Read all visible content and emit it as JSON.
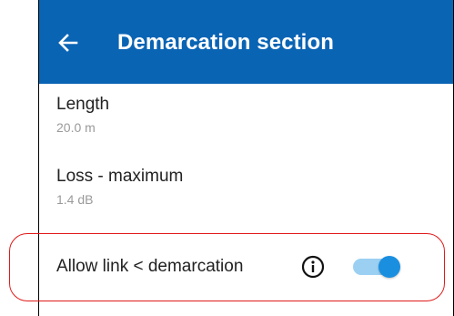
{
  "header": {
    "title": "Demarcation section",
    "back_icon": "arrow-left-icon",
    "background": "#0a64b4"
  },
  "settings": [
    {
      "label": "Length",
      "value": "20.0 m"
    },
    {
      "label": "Loss - maximum",
      "value": "1.4 dB"
    }
  ],
  "allow_link": {
    "label": "Allow link < demarcation",
    "info_icon": "info-icon",
    "toggle_on": true,
    "toggle_color": "#1a8fe0"
  },
  "highlight_color": "#e01a1a"
}
